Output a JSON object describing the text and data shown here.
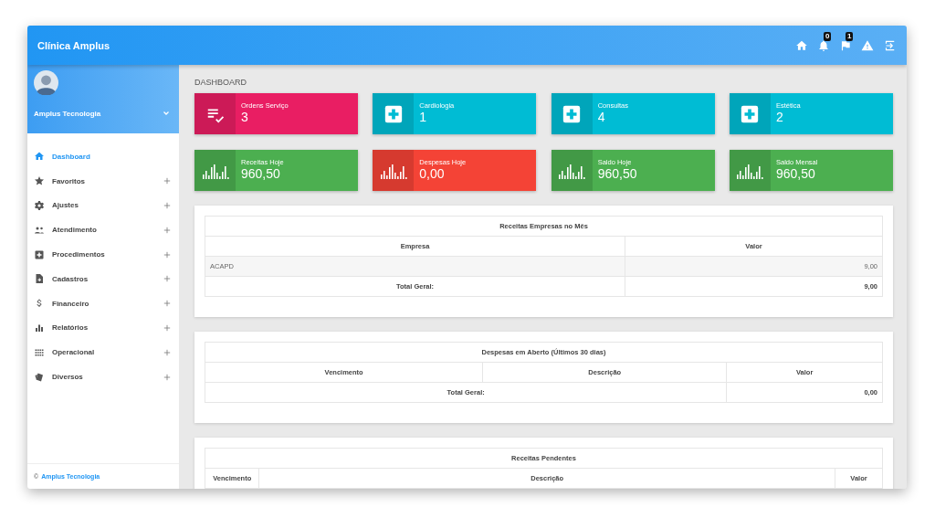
{
  "topbar": {
    "title": "Clínica Amplus",
    "badges": [
      "0",
      "1"
    ]
  },
  "profile": {
    "name": "Amplus Tecnologia"
  },
  "menu": [
    {
      "label": "Dashboard",
      "selected": true,
      "expandable": false
    },
    {
      "label": "Favoritos",
      "selected": false,
      "expandable": true
    },
    {
      "label": "Ajustes",
      "selected": false,
      "expandable": true
    },
    {
      "label": "Atendimento",
      "selected": false,
      "expandable": true
    },
    {
      "label": "Procedimentos",
      "selected": false,
      "expandable": true
    },
    {
      "label": "Cadastros",
      "selected": false,
      "expandable": true
    },
    {
      "label": "Financeiro",
      "selected": false,
      "expandable": true
    },
    {
      "label": "Relatórios",
      "selected": false,
      "expandable": true
    },
    {
      "label": "Operacional",
      "selected": false,
      "expandable": true
    },
    {
      "label": "Diversos",
      "selected": false,
      "expandable": true
    }
  ],
  "footer": {
    "symbol": "©",
    "link": "Amplus Tecnologia"
  },
  "page_title": "DASHBOARD",
  "cards": [
    {
      "kind": "tasks",
      "label": "Ordens Serviço",
      "value": "3",
      "color": "#e91e63"
    },
    {
      "kind": "medical",
      "label": "Cardiologia",
      "value": "1",
      "color": "#00bcd4"
    },
    {
      "kind": "medical",
      "label": "Consultas",
      "value": "4",
      "color": "#00bcd4"
    },
    {
      "kind": "medical",
      "label": "Estética",
      "value": "2",
      "color": "#00bcd4"
    },
    {
      "kind": "chart",
      "label": "Receitas Hoje",
      "value": "960,50",
      "color": "#4caf50"
    },
    {
      "kind": "chart",
      "label": "Despesas Hoje",
      "value": "0,00",
      "color": "#f44336"
    },
    {
      "kind": "chart",
      "label": "Saldo Hoje",
      "value": "960,50",
      "color": "#4caf50"
    },
    {
      "kind": "chart",
      "label": "Saldo Mensal",
      "value": "960,50",
      "color": "#4caf50"
    }
  ],
  "tables": [
    {
      "title": "Receitas Empresas no Mês",
      "columns": [
        "Empresa",
        "Valor"
      ],
      "rows": [
        [
          "ACAPD",
          "9,00"
        ]
      ],
      "total": {
        "label": "Total Geral:",
        "value": "9,00"
      }
    },
    {
      "title": "Despesas em Aberto (Últimos 30 dias)",
      "columns": [
        "Vencimento",
        "Descrição",
        "Valor"
      ],
      "total": {
        "label": "Total Geral:",
        "value": "0,00"
      }
    },
    {
      "title": "Receitas Pendentes",
      "columns": [
        "Vencimento",
        "Descrição",
        "Valor"
      ]
    }
  ]
}
